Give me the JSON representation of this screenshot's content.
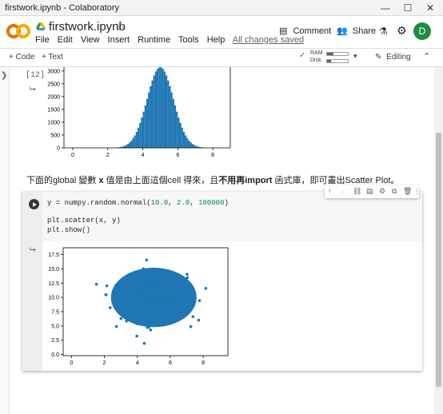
{
  "window": {
    "title": "firstwork.ipynb - Colaboratory",
    "min": "—",
    "max": "☐",
    "close": "✕"
  },
  "header": {
    "logo_text": "CO",
    "filename": "firstwork.ipynb",
    "menu": [
      "File",
      "Edit",
      "View",
      "Insert",
      "Runtime",
      "Tools",
      "Help"
    ],
    "saved_status": "All changes saved",
    "comment_label": "Comment",
    "share_label": "Share",
    "avatar_letter": "D"
  },
  "toolbar": {
    "add_code": "+ Code",
    "add_text": "+ Text",
    "ram_label": "RAM",
    "disk_label": "Disk",
    "ram_fraction": 0.3,
    "disk_fraction": 0.2,
    "editing_label": "Editing"
  },
  "cell1": {
    "exec_count": "[12]"
  },
  "histogram": {
    "type": "bar",
    "yticks": [
      "3000",
      "2500",
      "2000",
      "1500",
      "1000",
      "500",
      "0"
    ],
    "xticks": [
      "0",
      "2",
      "4",
      "6",
      "8"
    ],
    "xlim": [
      -0.5,
      9
    ],
    "ylim": [
      0,
      3150
    ],
    "bin_width": 0.1,
    "mean": 5.0,
    "std": 0.75,
    "peak": 3150
  },
  "markdown_text": {
    "part1": "下面的global 變數 ",
    "bold1": "x",
    "part2": " 值是由上面這個cell 得來，且",
    "bold2": "不用再import",
    "part3": " 函式庫，即可畫出Scatter Plot。"
  },
  "cell2": {
    "line1_pre": "y = numpy.random.normal(",
    "line1_n1": "10.0",
    "line1_sep1": ", ",
    "line1_n2": "2.0",
    "line1_sep2": ", ",
    "line1_n3": "100000",
    "line1_post": ")",
    "line2": "plt.scatter(x, y)",
    "line3": "plt.show()"
  },
  "chart_data": [
    {
      "type": "scatter",
      "yticks": [
        "17.5",
        "15.0",
        "12.5",
        "10.0",
        "7.5",
        "5.0",
        "2.5",
        "0.0"
      ],
      "xticks": [
        "0",
        "2",
        "4",
        "6",
        "8"
      ],
      "xlim": [
        -0.5,
        9.5
      ],
      "ylim": [
        -0.2,
        18.7
      ],
      "x_mean": 5.0,
      "x_std": 1.0,
      "y_mean": 10.0,
      "y_std": 2.0,
      "color": "#1f77b4"
    }
  ],
  "colors": {
    "accent": "#1f77b4",
    "avatar": "#1e8e3e",
    "logo_orange": "#f9ab00"
  }
}
